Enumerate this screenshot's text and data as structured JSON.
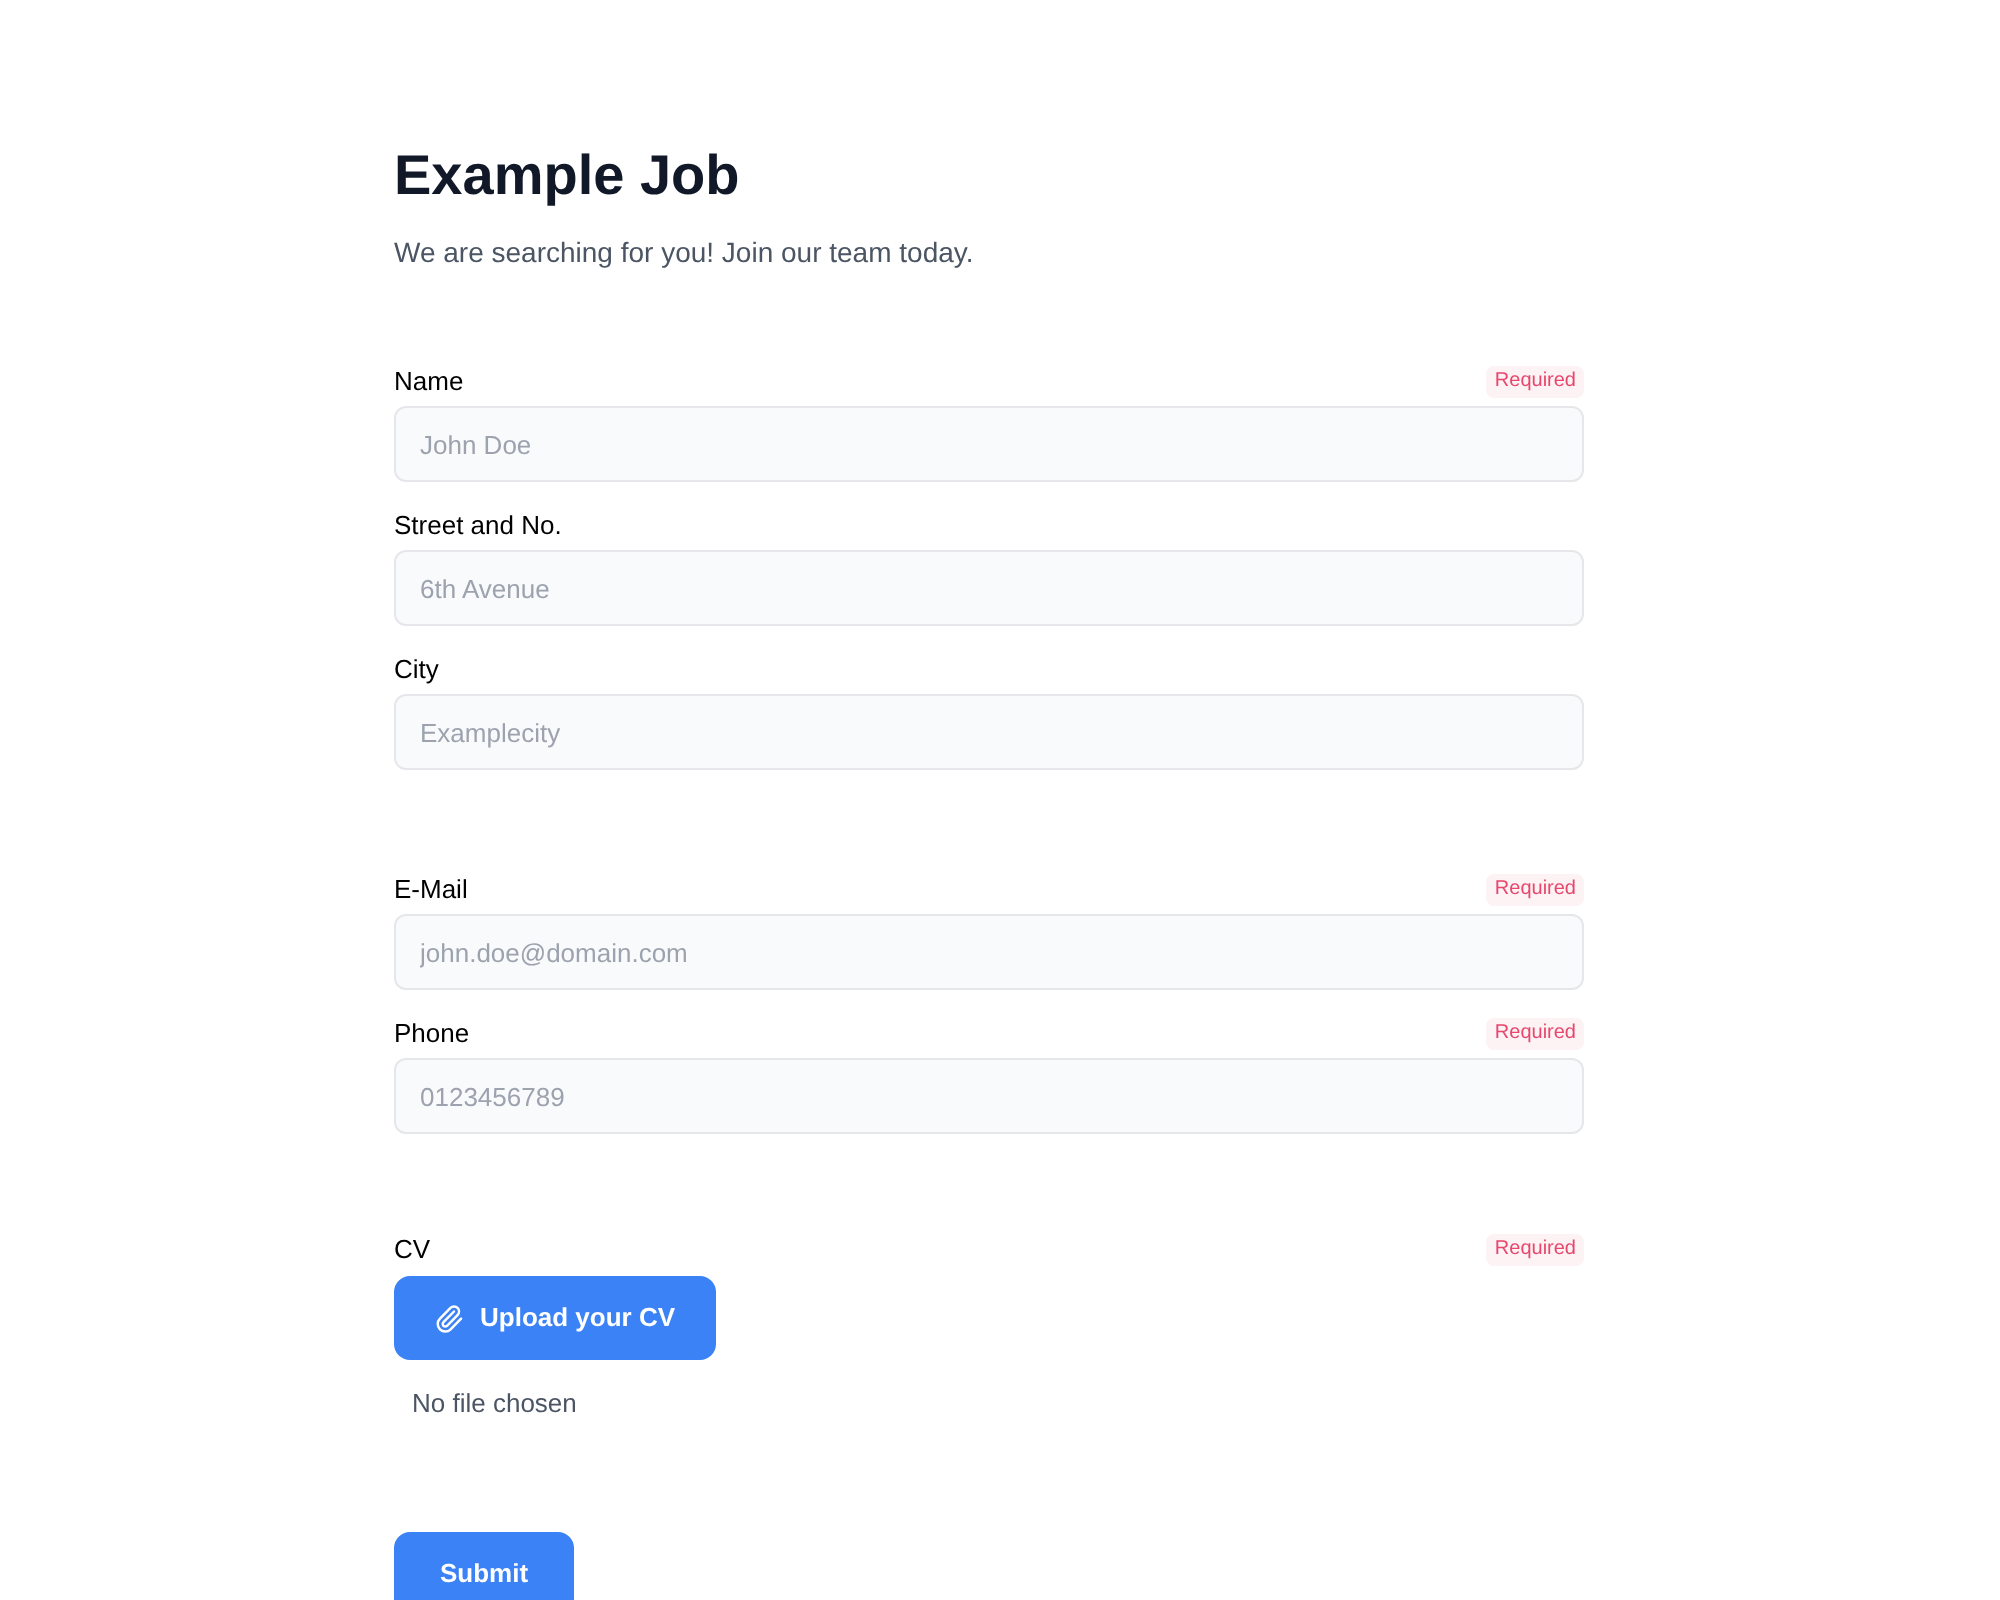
{
  "title": "Example Job",
  "subtitle": "We are searching for you! Join our team today.",
  "groups": [
    {
      "fields": [
        {
          "label": "Name",
          "placeholder": "John Doe",
          "badge": "Required"
        },
        {
          "label": "Street and No.",
          "placeholder": "6th Avenue"
        },
        {
          "label": "City",
          "placeholder": "Examplecity"
        }
      ]
    },
    {
      "fields": [
        {
          "label": "E-Mail",
          "placeholder": "john.doe@domain.com",
          "badge": "Required"
        },
        {
          "label": "Phone",
          "placeholder": "0123456789",
          "badge": "Required"
        }
      ]
    }
  ],
  "upload": {
    "label": "CV",
    "badge": "Required",
    "button": "Upload your CV",
    "status": "No file chosen"
  },
  "submit": "Submit"
}
